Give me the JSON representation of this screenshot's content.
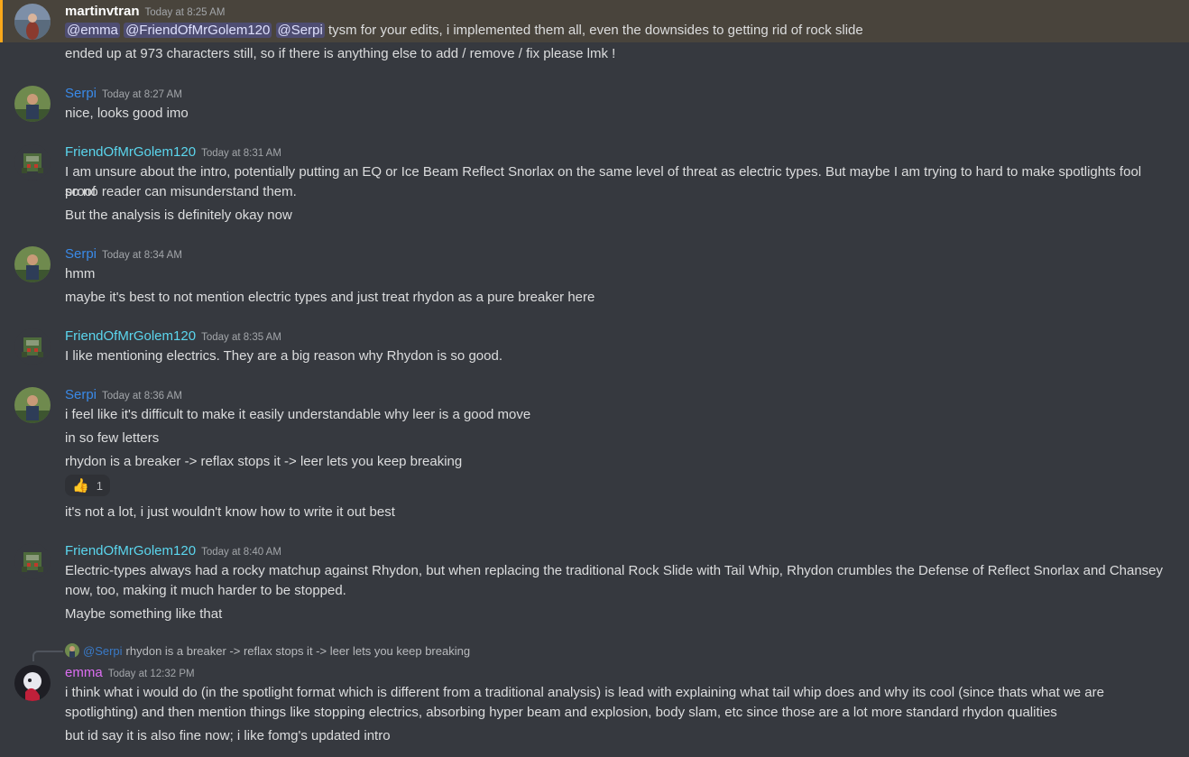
{
  "colors": {
    "background": "#36393f",
    "highlight_bg": "#49443c",
    "highlight_bar": "#faa81a",
    "serpi": "#3a8ae8",
    "fomg": "#5bd6ee",
    "emma": "#dc6ef2"
  },
  "messages": [
    {
      "author": "martinvtran",
      "time": "Today at 8:25 AM",
      "mentions": [
        "@emma",
        "@FriendOfMrGolem120",
        "@Serpi"
      ],
      "first_text": "tysm for your edits, i implemented them all, even the downsides to getting rid of rock slide",
      "lines": [
        "ended up at 973 characters still, so if there is anything else to add / remove / fix please lmk !"
      ]
    },
    {
      "author": "Serpi",
      "time": "Today at 8:27 AM",
      "lines": [
        "nice, looks good imo"
      ]
    },
    {
      "author": "FriendOfMrGolem120",
      "time": "Today at 8:31 AM",
      "lines": [
        "I am unsure about the intro, potentially putting an EQ or Ice Beam Reflect Snorlax on the same level of threat as electric types. But maybe I am trying to hard to make spotlights fool proof",
        "so no reader can misunderstand them.",
        "But the analysis is definitely okay now"
      ]
    },
    {
      "author": "Serpi",
      "time": "Today at 8:34 AM",
      "lines": [
        "hmm",
        "maybe it's best to not mention electric types and just treat rhydon as a pure breaker here"
      ]
    },
    {
      "author": "FriendOfMrGolem120",
      "time": "Today at 8:35 AM",
      "lines": [
        "I like mentioning electrics. They are a big reason why Rhydon is so good."
      ]
    },
    {
      "author": "Serpi",
      "time": "Today at 8:36 AM",
      "lines": [
        "i feel like it's difficult to make it easily understandable why leer is a good move",
        "in so few letters",
        "rhydon is a breaker -> reflax stops it -> leer lets you keep breaking",
        "it's not a lot, i just wouldn't know how to write it out best"
      ],
      "reaction": {
        "emoji": "👍",
        "count": "1"
      }
    },
    {
      "author": "FriendOfMrGolem120",
      "time": "Today at 8:40 AM",
      "lines": [
        "Electric-types always had a rocky matchup against Rhydon, but when replacing the traditional Rock Slide with Tail Whip, Rhydon crumbles the Defense of Reflect Snorlax and Chansey",
        "now, too, making it much harder to be stopped.",
        "Maybe something like that"
      ]
    },
    {
      "author": "emma",
      "time": "Today at 12:32 PM",
      "reply": {
        "name": "@Serpi",
        "text": "rhydon is a breaker -> reflax stops it -> leer lets you keep breaking"
      },
      "lines": [
        "i think what i would do (in the spotlight format which is different from a traditional analysis) is lead with explaining what tail whip does and why its cool (since thats what we are",
        "spotlighting) and then mention things like stopping electrics, absorbing hyper beam and explosion, body slam, etc since those are a lot more standard rhydon qualities",
        "but id say it is also fine now; i like fomg's updated intro"
      ]
    }
  ]
}
